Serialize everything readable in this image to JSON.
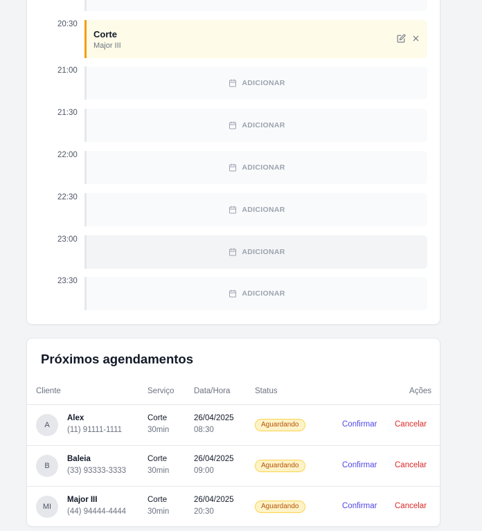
{
  "schedule": {
    "booked": {
      "time": "20:30",
      "service": "Corte",
      "client": "Major III",
      "edit_icon": "edit-icon",
      "delete_icon": "close-icon"
    },
    "add_label": "ADICIONAR",
    "slots": [
      {
        "time": "21:00"
      },
      {
        "time": "21:30"
      },
      {
        "time": "22:00"
      },
      {
        "time": "22:30"
      },
      {
        "time": "23:00"
      },
      {
        "time": "23:30"
      }
    ]
  },
  "upcoming": {
    "title": "Próximos agendamentos",
    "headers": {
      "client": "Cliente",
      "service": "Serviço",
      "datetime": "Data/Hora",
      "status": "Status",
      "actions": "Ações"
    },
    "confirm_label": "Confirmar",
    "cancel_label": "Cancelar",
    "rows": [
      {
        "initials": "A",
        "name": "Alex",
        "phone": "(11) 91111-1111",
        "service": "Corte",
        "duration": "30min",
        "date": "26/04/2025",
        "time": "08:30",
        "status": "Aguardando"
      },
      {
        "initials": "B",
        "name": "Baleia",
        "phone": "(33) 93333-3333",
        "service": "Corte",
        "duration": "30min",
        "date": "26/04/2025",
        "time": "09:00",
        "status": "Aguardando"
      },
      {
        "initials": "MI",
        "name": "Major III",
        "phone": "(44) 94444-4444",
        "service": "Corte",
        "duration": "30min",
        "date": "26/04/2025",
        "time": "20:30",
        "status": "Aguardando"
      }
    ]
  },
  "colors": {
    "booked_accent": "#f59e0b",
    "booked_bg": "#fefce8",
    "confirm": "#4f46e5",
    "cancel": "#dc2626",
    "badge_bg": "#fef3c7",
    "badge_text": "#b45309"
  }
}
